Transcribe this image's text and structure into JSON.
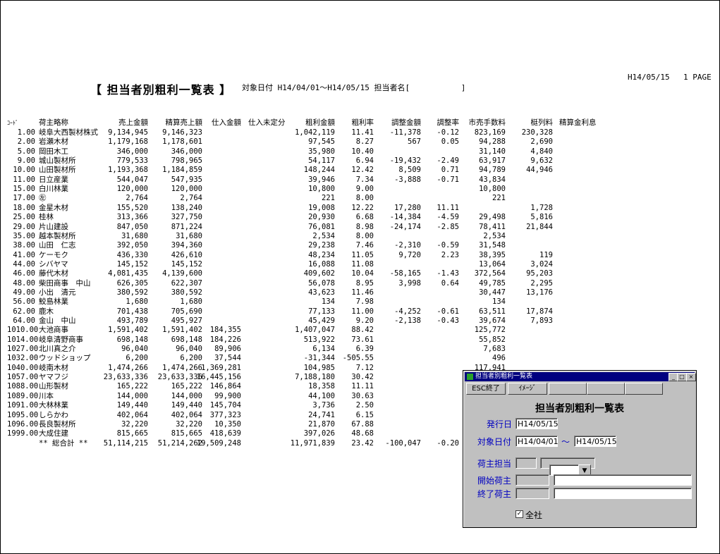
{
  "report": {
    "title": "【 担当者別粗利一覧表 】",
    "condition": "対象日付 H14/04/01～H14/05/15 担当者名[　　　　　　 ]",
    "print_date": "H14/05/15",
    "page": "1 PAGE"
  },
  "table": {
    "headers": [
      "ｺｰﾄﾞ",
      "荷主略称",
      "売上金額",
      "精算売上額",
      "仕入金額",
      "仕入未定分",
      "粗利金額",
      "粗利率",
      "調整金額",
      "調整率",
      "市売手数料",
      "梃列料",
      "精算金利息"
    ],
    "rows": [
      [
        "1.00",
        "岐阜大西製材株式",
        "9,134,945",
        "9,146,323",
        "",
        "",
        "1,042,119",
        "11.41",
        "-11,378",
        "-0.12",
        "823,169",
        "230,328",
        ""
      ],
      [
        "2.00",
        "岩瀬木材",
        "1,179,168",
        "1,178,601",
        "",
        "",
        "97,545",
        "8.27",
        "567",
        "0.05",
        "94,288",
        "2,690",
        ""
      ],
      [
        "5.00",
        "岡田木工",
        "346,000",
        "346,000",
        "",
        "",
        "35,980",
        "10.40",
        "",
        "",
        "31,140",
        "4,840",
        ""
      ],
      [
        "9.00",
        "城山製材所",
        "779,533",
        "798,965",
        "",
        "",
        "54,117",
        "6.94",
        "-19,432",
        "-2.49",
        "63,917",
        "9,632",
        ""
      ],
      [
        "10.00",
        "山田製材所",
        "1,193,368",
        "1,184,859",
        "",
        "",
        "148,244",
        "12.42",
        "8,509",
        "0.71",
        "94,789",
        "44,946",
        ""
      ],
      [
        "11.00",
        "日立産業",
        "544,047",
        "547,935",
        "",
        "",
        "39,946",
        "7.34",
        "-3,888",
        "-0.71",
        "43,834",
        "",
        ""
      ],
      [
        "15.00",
        "白川林業",
        "120,000",
        "120,000",
        "",
        "",
        "10,800",
        "9.00",
        "",
        "",
        "10,800",
        "",
        ""
      ],
      [
        "17.00",
        "㊧",
        "2,764",
        "2,764",
        "",
        "",
        "221",
        "8.00",
        "",
        "",
        "221",
        "",
        ""
      ],
      [
        "18.00",
        "金星木材",
        "155,520",
        "138,240",
        "",
        "",
        "19,008",
        "12.22",
        "17,280",
        "11.11",
        "",
        "1,728",
        ""
      ],
      [
        "25.00",
        "桂林",
        "313,366",
        "327,750",
        "",
        "",
        "20,930",
        "6.68",
        "-14,384",
        "-4.59",
        "29,498",
        "5,816",
        ""
      ],
      [
        "29.00",
        "片山建設",
        "847,050",
        "871,224",
        "",
        "",
        "76,081",
        "8.98",
        "-24,174",
        "-2.85",
        "78,411",
        "21,844",
        ""
      ],
      [
        "35.00",
        "越本製材所",
        "31,680",
        "31,680",
        "",
        "",
        "2,534",
        "8.00",
        "",
        "",
        "2,534",
        "",
        ""
      ],
      [
        "38.00",
        "山田　仁志",
        "392,050",
        "394,360",
        "",
        "",
        "29,238",
        "7.46",
        "-2,310",
        "-0.59",
        "31,548",
        "",
        ""
      ],
      [
        "41.00",
        "ケーモク",
        "436,330",
        "426,610",
        "",
        "",
        "48,234",
        "11.05",
        "9,720",
        "2.23",
        "38,395",
        "119",
        ""
      ],
      [
        "44.00",
        "シバヤマ",
        "145,152",
        "145,152",
        "",
        "",
        "16,088",
        "11.08",
        "",
        "",
        "13,064",
        "3,024",
        ""
      ],
      [
        "46.00",
        "藤代木材",
        "4,081,435",
        "4,139,600",
        "",
        "",
        "409,602",
        "10.04",
        "-58,165",
        "-1.43",
        "372,564",
        "95,203",
        ""
      ],
      [
        "48.00",
        "柴田商事　中山",
        "626,305",
        "622,307",
        "",
        "",
        "56,078",
        "8.95",
        "3,998",
        "0.64",
        "49,785",
        "2,295",
        ""
      ],
      [
        "49.00",
        "小出　清元",
        "380,592",
        "380,592",
        "",
        "",
        "43,623",
        "11.46",
        "",
        "",
        "30,447",
        "13,176",
        ""
      ],
      [
        "56.00",
        "鮫島林業",
        "1,680",
        "1,680",
        "",
        "",
        "134",
        "7.98",
        "",
        "",
        "134",
        "",
        ""
      ],
      [
        "62.00",
        "鹿木",
        "701,438",
        "705,690",
        "",
        "",
        "77,133",
        "11.00",
        "-4,252",
        "-0.61",
        "63,511",
        "17,874",
        ""
      ],
      [
        "64.00",
        "金山　中山",
        "493,789",
        "495,927",
        "",
        "",
        "45,429",
        "9.20",
        "-2,138",
        "-0.43",
        "39,674",
        "7,893",
        ""
      ],
      [
        "1010.00",
        "大池商事",
        "1,591,402",
        "1,591,402",
        "184,355",
        "",
        "1,407,047",
        "88.42",
        "",
        "",
        "125,772",
        "",
        ""
      ],
      [
        "1014.00",
        "岐阜清野商事",
        "698,148",
        "698,148",
        "184,226",
        "",
        "513,922",
        "73.61",
        "",
        "",
        "55,852",
        "",
        ""
      ],
      [
        "1027.00",
        "北川真之介",
        "96,040",
        "96,040",
        "89,906",
        "",
        "6,134",
        "6.39",
        "",
        "",
        "7,683",
        "",
        ""
      ],
      [
        "1032.00",
        "ウッドショップ",
        "6,200",
        "6,200",
        "37,544",
        "",
        "-31,344",
        "-505.55",
        "",
        "",
        "496",
        "",
        ""
      ],
      [
        "1040.00",
        "岐南木材",
        "1,474,266",
        "1,474,266",
        "1,369,281",
        "",
        "104,985",
        "7.12",
        "",
        "",
        "117,941",
        "",
        ""
      ],
      [
        "1057.00",
        "ヤマフジ",
        "23,633,336",
        "23,633,336",
        "16,445,156",
        "",
        "7,188,180",
        "30.42",
        "",
        "",
        "",
        "",
        ""
      ],
      [
        "1088.00",
        "山形製材",
        "165,222",
        "165,222",
        "146,864",
        "",
        "18,358",
        "11.11",
        "",
        "",
        "",
        "",
        ""
      ],
      [
        "1089.00",
        "川本",
        "144,000",
        "144,000",
        "99,900",
        "",
        "44,100",
        "30.63",
        "",
        "",
        "",
        "",
        ""
      ],
      [
        "1091.00",
        "大林林業",
        "149,440",
        "149,440",
        "145,704",
        "",
        "3,736",
        "2.50",
        "",
        "",
        "",
        "",
        ""
      ],
      [
        "1095.00",
        "しらかわ",
        "402,064",
        "402,064",
        "377,323",
        "",
        "24,741",
        "6.15",
        "",
        "",
        "",
        "",
        ""
      ],
      [
        "1096.00",
        "長良製材所",
        "32,220",
        "32,220",
        "10,350",
        "",
        "21,870",
        "67.88",
        "",
        "",
        "",
        "",
        ""
      ],
      [
        "1999.00",
        "大成住建",
        "815,665",
        "815,665",
        "418,639",
        "",
        "397,026",
        "48.68",
        "",
        "",
        "",
        "",
        ""
      ]
    ],
    "total": [
      "",
      "** 総合計 **",
      "51,114,215",
      "51,214,262",
      "19,509,248",
      "",
      "11,971,839",
      "23.42",
      "-100,047",
      "-0.20",
      "",
      "",
      ""
    ]
  },
  "dialog": {
    "window_title": "担当者別粗利一覧表",
    "btn_min": "_",
    "btn_max": "□",
    "btn_close": "×",
    "toolbar": [
      "ESC終了",
      "ｲﾒｰｼﾞ"
    ],
    "heading": "担当者別粗利一覧表",
    "issue_date_label": "発行日",
    "issue_date": "H14/05/15",
    "target_date_label": "対象日付",
    "date_from": "H14/04/01",
    "tilde": "～",
    "date_to": "H14/05/15",
    "shipper_staff_label": "荷主担当",
    "start_shipper_label": "開始荷主",
    "end_shipper_label": "終了荷主",
    "all_company_label": "全社",
    "all_company_checked": true,
    "check_mark": "✓",
    "combo_arrow": "▼"
  }
}
